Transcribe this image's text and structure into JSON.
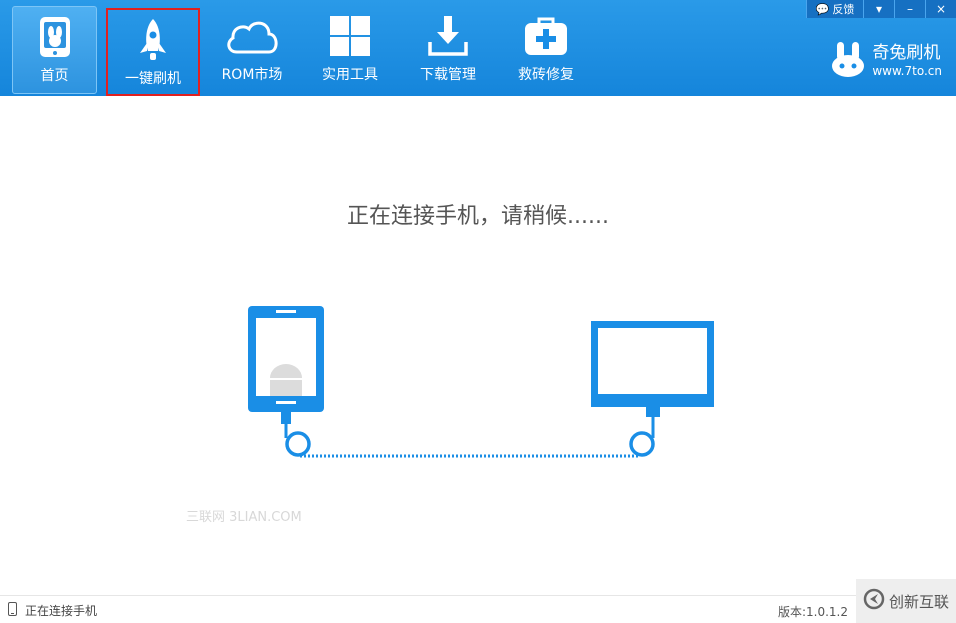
{
  "window": {
    "feedback_label": "反馈",
    "dropdown_icon": "▾",
    "minimize_icon": "–",
    "close_icon": "×"
  },
  "nav": [
    {
      "id": "home",
      "label": "首页",
      "icon": "phone-rabbit-icon"
    },
    {
      "id": "flash",
      "label": "一键刷机",
      "icon": "rocket-icon"
    },
    {
      "id": "rom",
      "label": "ROM市场",
      "icon": "cloud-icon"
    },
    {
      "id": "tools",
      "label": "实用工具",
      "icon": "grid-icon"
    },
    {
      "id": "download",
      "label": "下载管理",
      "icon": "download-icon"
    },
    {
      "id": "rescue",
      "label": "救砖修复",
      "icon": "first-aid-icon"
    }
  ],
  "brand": {
    "name": "奇兔刷机",
    "url": "www.7to.cn"
  },
  "main": {
    "headline": "正在连接手机，请稍候......"
  },
  "watermark": "三联网 3LIAN.COM",
  "status": {
    "text": "正在连接手机",
    "version": "版本:1.0.1.2"
  },
  "corner_logo": {
    "text": "创新互联"
  },
  "colors": {
    "accent": "#1a8ee6",
    "highlight_border": "#e02020"
  }
}
